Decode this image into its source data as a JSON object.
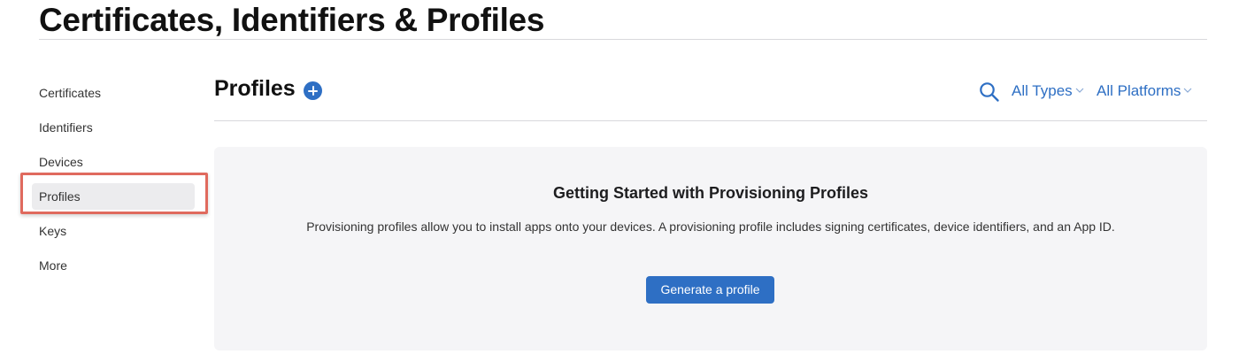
{
  "header": {
    "title": "Certificates, Identifiers & Profiles"
  },
  "sidebar": {
    "items": [
      {
        "label": "Certificates",
        "active": false
      },
      {
        "label": "Identifiers",
        "active": false
      },
      {
        "label": "Devices",
        "active": false
      },
      {
        "label": "Profiles",
        "active": true
      },
      {
        "label": "Keys",
        "active": false
      },
      {
        "label": "More",
        "active": false
      }
    ],
    "highlight_color": "#e06a5e"
  },
  "main": {
    "section_title": "Profiles",
    "add_icon": "plus-circle-icon",
    "search_icon": "search-icon",
    "filters": {
      "type_label": "All Types",
      "platform_label": "All Platforms"
    },
    "empty_state": {
      "title": "Getting Started with Provisioning Profiles",
      "description": "Provisioning profiles allow you to install apps onto your devices. A provisioning profile includes signing certificates, device identifiers, and an App ID.",
      "button_label": "Generate a profile"
    }
  },
  "colors": {
    "accent": "#2e6fc4",
    "panel_bg": "#f5f5f7",
    "active_item_bg": "#ececee"
  }
}
